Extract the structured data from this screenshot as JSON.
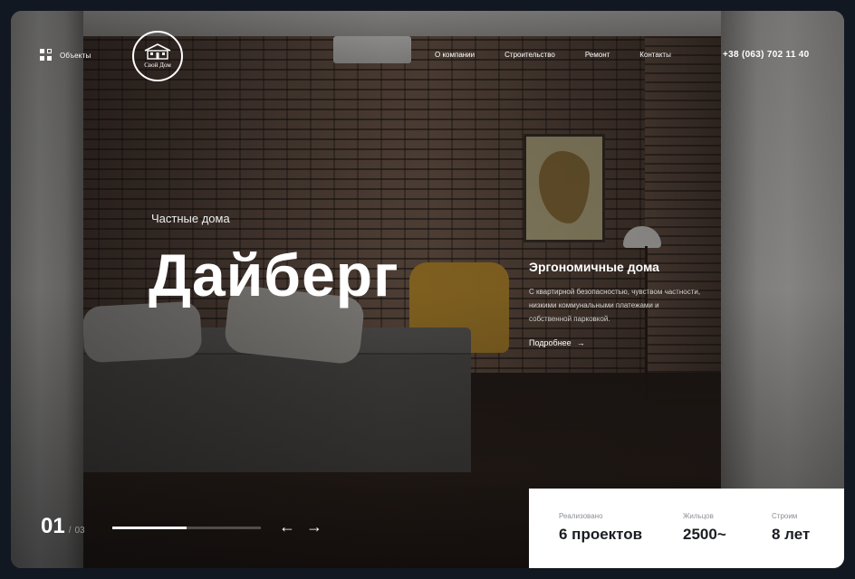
{
  "header": {
    "menu_label": "Объекты",
    "logo_text": "Свой Дом",
    "nav": [
      "О компании",
      "Строительство",
      "Ремонт",
      "Контакты"
    ],
    "phone": "+38 (063) 702 11 40"
  },
  "hero": {
    "subtitle": "Частные дома",
    "title": "Дайберг"
  },
  "feature": {
    "title": "Эргономичные дома",
    "description": "С квартирной безопасностью, чувством частности, низкими коммунальными платежами и собственной парковкой.",
    "more_label": "Подробнее",
    "more_arrow": "→"
  },
  "slider": {
    "current": "01",
    "separator": "/",
    "total": "03",
    "progress_fraction": 0.5,
    "prev_arrow": "←",
    "next_arrow": "→"
  },
  "stats": [
    {
      "label": "Реализовано",
      "value": "6 проектов"
    },
    {
      "label": "Жильцов",
      "value": "2500~"
    },
    {
      "label": "Строим",
      "value": "8 лет"
    }
  ]
}
